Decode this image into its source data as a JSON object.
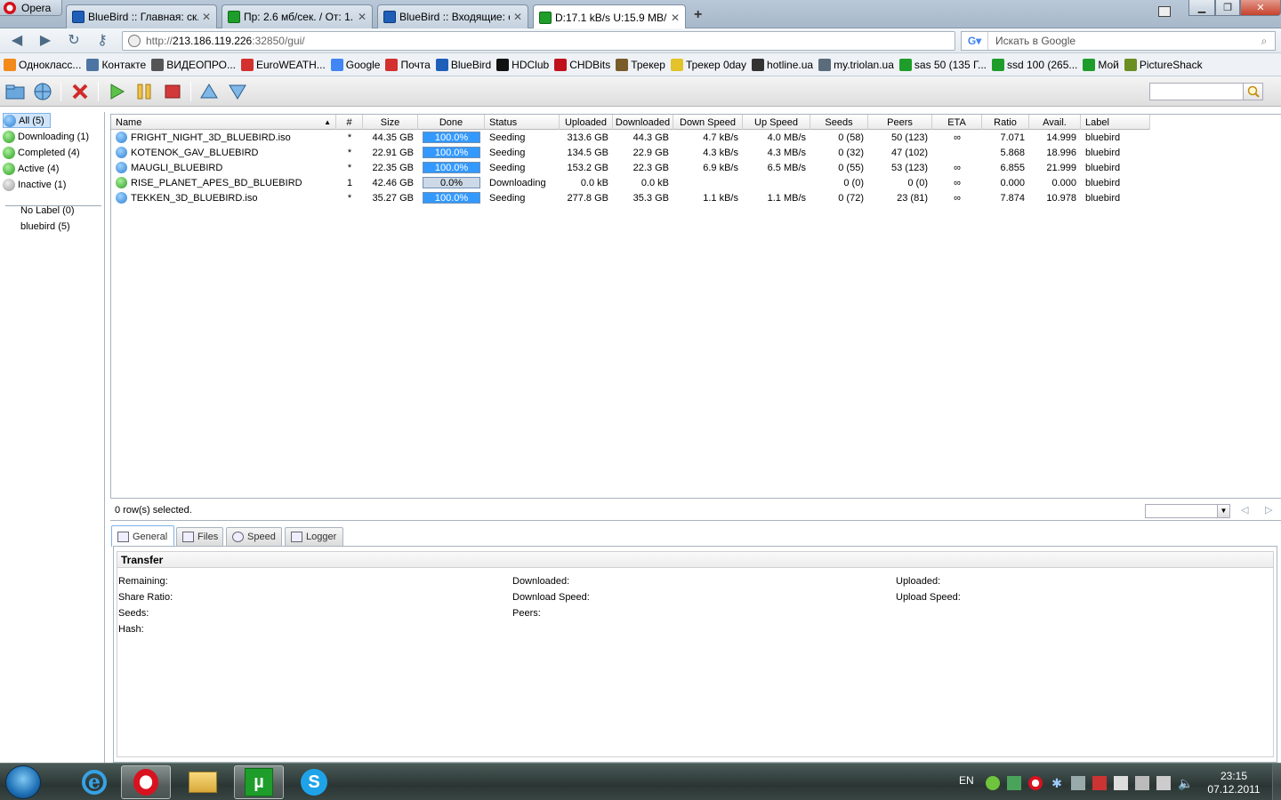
{
  "browser": {
    "menu_label": "Opera",
    "tabs": [
      {
        "label": "BlueBird :: Главная: ск...",
        "icon": "bluebird-favicon-icon"
      },
      {
        "label": "Пр: 2.6 мб/сек. / От: 1...",
        "icon": "utorrent-favicon-icon"
      },
      {
        "label": "BlueBird :: Входящие: с...",
        "icon": "bluebird-favicon-icon"
      },
      {
        "label": "D:17.1 kB/s U:15.9 MB/...",
        "icon": "utorrent-favicon-icon",
        "active": true
      }
    ],
    "url_prefix": "http://",
    "url_host": "213.186.119.226",
    "url_rest": ":32850/gui/",
    "search_placeholder": "Искать в Google",
    "bookmarks": [
      {
        "label": "Однокласс...",
        "color": "#f28a1c"
      },
      {
        "label": "Контакте",
        "color": "#4c75a3"
      },
      {
        "label": "ВИДЕОПРО...",
        "color": "#555555"
      },
      {
        "label": "EuroWEATH...",
        "color": "#d2312d"
      },
      {
        "label": "Google",
        "color": "#4285f4"
      },
      {
        "label": "Почта",
        "color": "#d2312d"
      },
      {
        "label": "BlueBird",
        "color": "#1f5fb8"
      },
      {
        "label": "HDClub",
        "color": "#111111"
      },
      {
        "label": "CHDBits",
        "color": "#c0121c"
      },
      {
        "label": "Трекер",
        "color": "#7a5b2a"
      },
      {
        "label": "Трекер 0day",
        "color": "#e3c22a"
      },
      {
        "label": "hotline.ua",
        "color": "#333333"
      },
      {
        "label": "my.triolan.ua",
        "color": "#5a6b7c"
      },
      {
        "label": "sas 50 (135 Г...",
        "color": "#1e9d2a"
      },
      {
        "label": "ssd 100 (265...",
        "color": "#1e9d2a"
      },
      {
        "label": "Мой",
        "color": "#1e9d2a"
      },
      {
        "label": "PictureShack",
        "color": "#6b8e23"
      }
    ]
  },
  "sidebar": {
    "categories": [
      {
        "label": "All (5)",
        "icon": "all-torrents-icon",
        "selected": true
      },
      {
        "label": "Downloading (1)",
        "icon": "downloading-icon"
      },
      {
        "label": "Completed (4)",
        "icon": "completed-icon"
      },
      {
        "label": "Active (4)",
        "icon": "active-icon"
      },
      {
        "label": "Inactive (1)",
        "icon": "inactive-icon"
      }
    ],
    "labels": [
      "No Label (0)",
      "bluebird (5)"
    ]
  },
  "grid": {
    "columns": [
      "Name",
      "#",
      "Size",
      "Done",
      "Status",
      "Uploaded",
      "Downloaded",
      "Down Speed",
      "Up Speed",
      "Seeds",
      "Peers",
      "ETA",
      "Ratio",
      "Avail.",
      "Label"
    ],
    "rows": [
      {
        "name": "FRIGHT_NIGHT_3D_BLUEBIRD.iso",
        "num": "*",
        "size": "44.35 GB",
        "done": "100.0%",
        "done_value": 1.0,
        "status": "Seeding",
        "uploaded": "313.6 GB",
        "downloaded": "44.3 GB",
        "down_speed": "4.7 kB/s",
        "up_speed": "4.0 MB/s",
        "seeds": "0 (58)",
        "peers": "50 (123)",
        "eta": "∞",
        "ratio": "7.071",
        "avail": "14.999",
        "label": "bluebird"
      },
      {
        "name": "KOTENOK_GAV_BLUEBIRD",
        "num": "*",
        "size": "22.91 GB",
        "done": "100.0%",
        "done_value": 1.0,
        "status": "Seeding",
        "uploaded": "134.5 GB",
        "downloaded": "22.9 GB",
        "down_speed": "4.3 kB/s",
        "up_speed": "4.3 MB/s",
        "seeds": "0 (32)",
        "peers": "47 (102)",
        "eta": "",
        "ratio": "5.868",
        "avail": "18.996",
        "label": "bluebird"
      },
      {
        "name": "MAUGLI_BLUEBIRD",
        "num": "*",
        "size": "22.35 GB",
        "done": "100.0%",
        "done_value": 1.0,
        "status": "Seeding",
        "uploaded": "153.2 GB",
        "downloaded": "22.3 GB",
        "down_speed": "6.9 kB/s",
        "up_speed": "6.5 MB/s",
        "seeds": "0 (55)",
        "peers": "53 (123)",
        "eta": "∞",
        "ratio": "6.855",
        "avail": "21.999",
        "label": "bluebird"
      },
      {
        "name": "RISE_PLANET_APES_BD_BLUEBIRD",
        "num": "1",
        "size": "42.46 GB",
        "done": "0.0%",
        "done_value": 0.0,
        "status": "Downloading",
        "uploaded": "0.0 kB",
        "downloaded": "0.0 kB",
        "down_speed": "",
        "up_speed": "",
        "seeds": "0 (0)",
        "peers": "0 (0)",
        "eta": "∞",
        "ratio": "0.000",
        "avail": "0.000",
        "label": "bluebird"
      },
      {
        "name": "TEKKEN_3D_BLUEBIRD.iso",
        "num": "*",
        "size": "35.27 GB",
        "done": "100.0%",
        "done_value": 1.0,
        "status": "Seeding",
        "uploaded": "277.8 GB",
        "downloaded": "35.3 GB",
        "down_speed": "1.1 kB/s",
        "up_speed": "1.1 MB/s",
        "seeds": "0 (72)",
        "peers": "23 (81)",
        "eta": "∞",
        "ratio": "7.874",
        "avail": "10.978",
        "label": "bluebird"
      }
    ],
    "status_text": "0 row(s) selected."
  },
  "details": {
    "tabs": [
      "General",
      "Files",
      "Speed",
      "Logger"
    ],
    "active_tab": "General",
    "section_title": "Transfer",
    "fields": {
      "remaining": "Remaining:",
      "share_ratio": "Share Ratio:",
      "seeds": "Seeds:",
      "hash": "Hash:",
      "downloaded": "Downloaded:",
      "download_speed": "Download Speed:",
      "peers": "Peers:",
      "uploaded": "Uploaded:",
      "upload_speed": "Upload Speed:"
    }
  },
  "taskbar": {
    "language": "EN",
    "time": "23:15",
    "date": "07.12.2011"
  },
  "colors": {
    "progress_fill": "#3399ff",
    "selected_category": "#cfe4fb"
  }
}
